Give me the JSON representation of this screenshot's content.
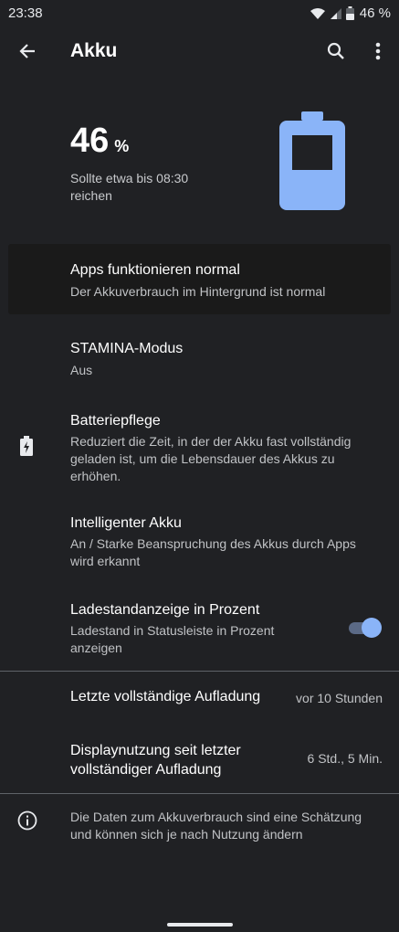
{
  "status_bar": {
    "time": "23:38",
    "battery_percent": "46 %",
    "icons": [
      "wifi-icon",
      "signal-icon",
      "battery-icon"
    ]
  },
  "toolbar": {
    "title": "Akku",
    "back_icon": "arrow-back-icon",
    "search_icon": "search-icon",
    "menu_icon": "more-vert-icon"
  },
  "header": {
    "percent_value": "46",
    "percent_unit": "%",
    "estimate": "Sollte etwa bis 08:30 reichen",
    "battery_level": 0.46,
    "accent": "#8ab4f8"
  },
  "items": {
    "apps": {
      "title": "Apps funktionieren normal",
      "subtitle": "Der Akkuverbrauch im Hintergrund ist normal"
    },
    "stamina": {
      "title": "STAMINA-Modus",
      "subtitle": "Aus"
    },
    "care": {
      "title": "Batteriepflege",
      "subtitle": "Reduziert die Zeit, in der der Akku fast vollständig geladen ist, um die Lebensdauer des Akkus zu erhöhen."
    },
    "smart": {
      "title": "Intelligenter Akku",
      "subtitle": "An / Starke Beanspruchung des Akkus durch Apps wird erkannt"
    },
    "percent_display": {
      "title": "Ladestandanzeige in Prozent",
      "subtitle": "Ladestand in Statusleiste in Prozent anzeigen",
      "enabled": true
    }
  },
  "stats": {
    "last_charge": {
      "label": "Letzte vollständige Aufladung",
      "value": "vor 10 Stunden"
    },
    "screen_usage": {
      "label": "Displaynutzung seit letzter vollständiger Aufladung",
      "value": "6 Std., 5 Min."
    }
  },
  "footer": {
    "info_icon": "info-icon",
    "note": "Die Daten zum Akkuverbrauch sind eine Schätzung und können sich je nach Nutzung ändern"
  }
}
